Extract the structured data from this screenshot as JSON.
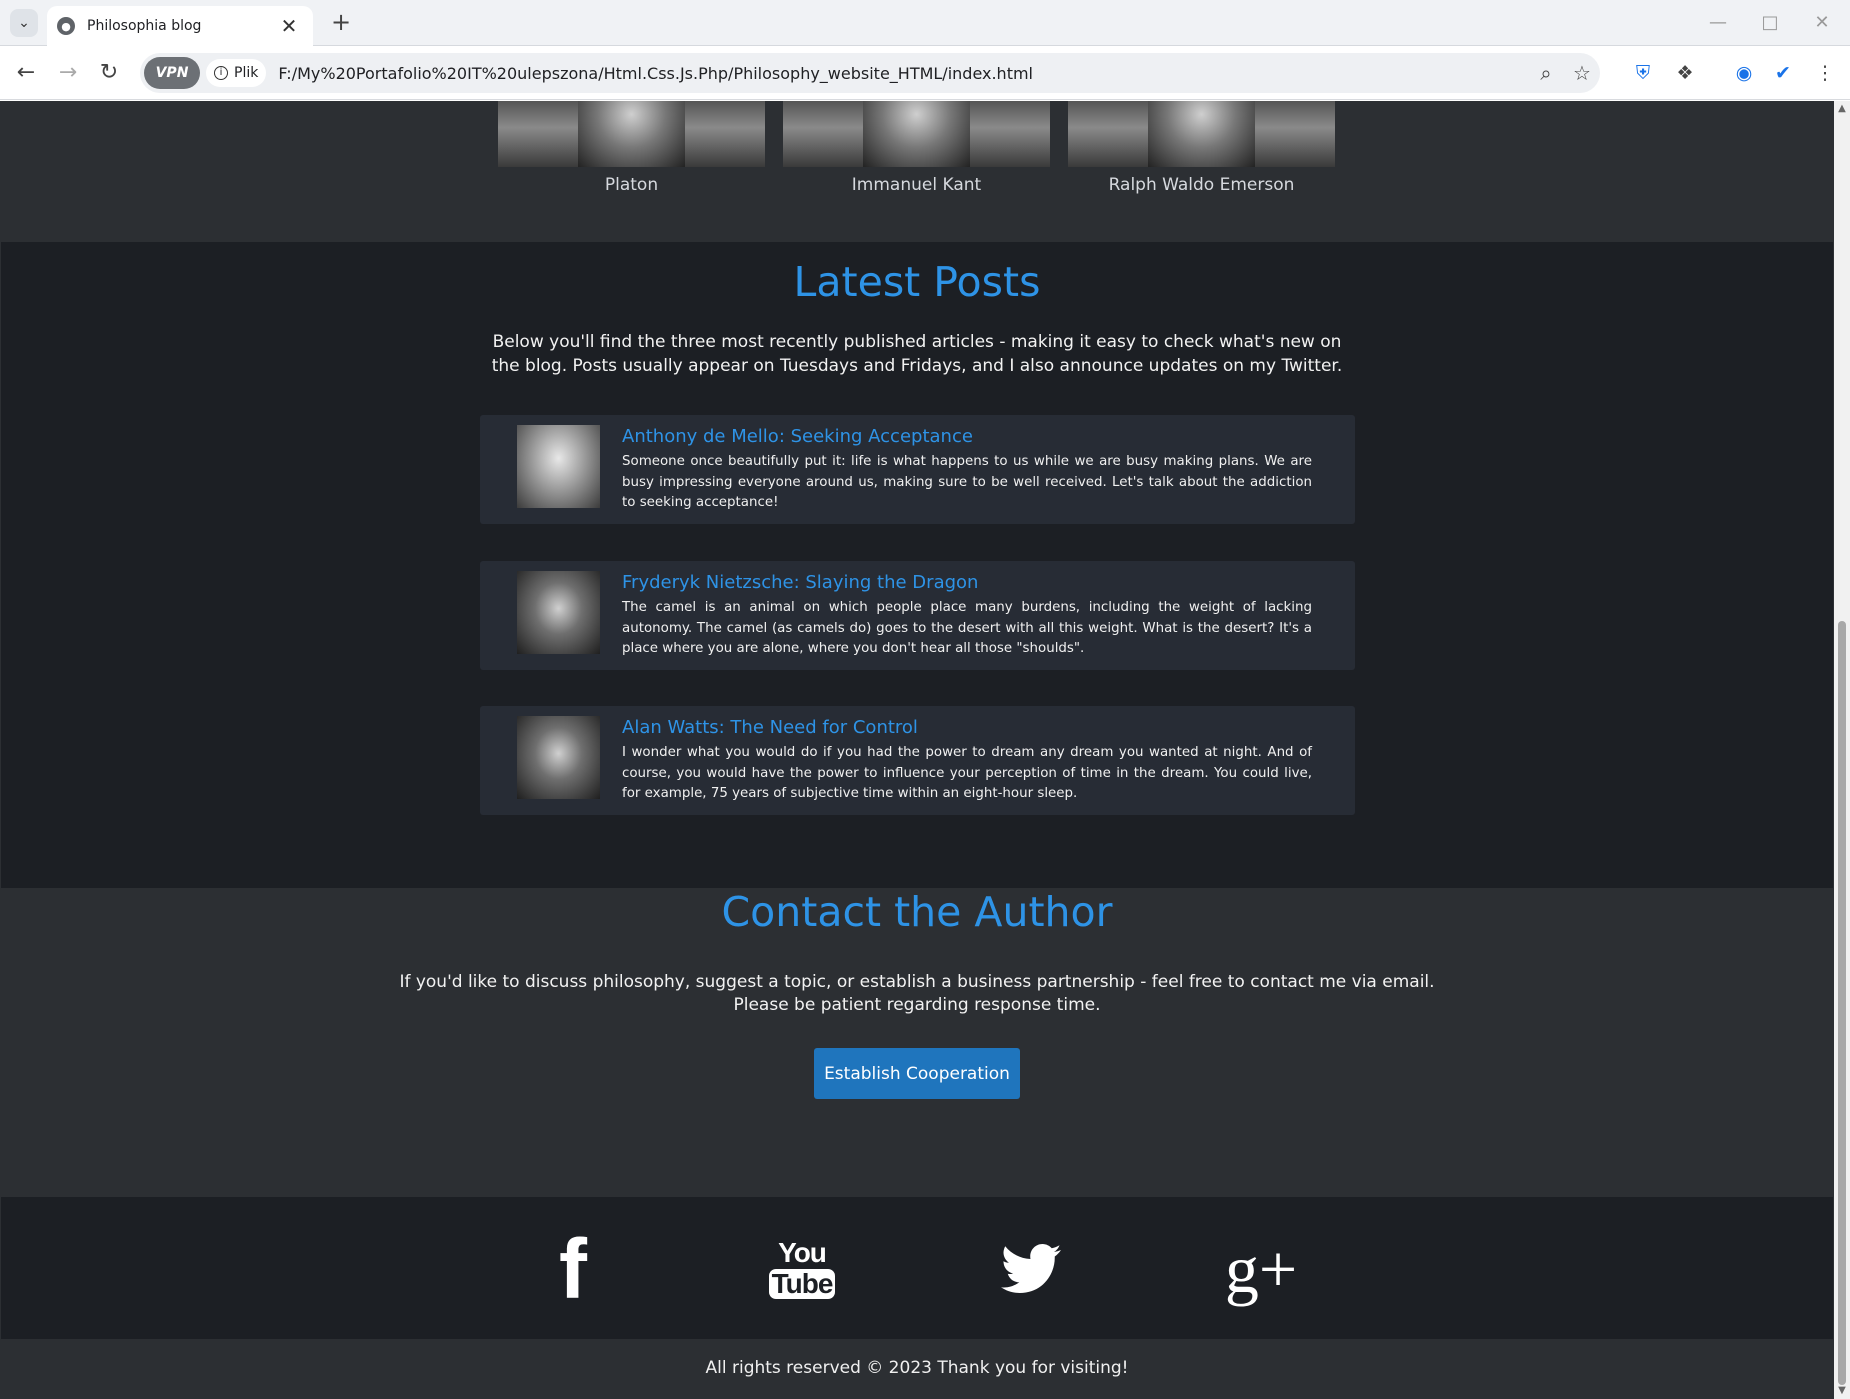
{
  "browser": {
    "tab_title": "Philosophia blog",
    "site_info_label": "Plik",
    "vpn_label": "VPN",
    "url": "F:/My%20Portafolio%20IT%20ulepszona/Html.Css.Js.Php/Philosophy_website_HTML/index.html"
  },
  "philosophers": [
    {
      "name": "Platon"
    },
    {
      "name": "Immanuel Kant"
    },
    {
      "name": "Ralph Waldo Emerson"
    }
  ],
  "latest_posts": {
    "title": "Latest Posts",
    "description": "Below you'll find the three most recently published articles - making it easy to check what's new on the blog. Posts usually appear on Tuesdays and Fridays, and I also announce updates on my Twitter.",
    "posts": [
      {
        "title": "Anthony de Mello: Seeking Acceptance",
        "excerpt": "Someone once beautifully put it: life is what happens to us while we are busy making plans. We are busy impressing everyone around us, making sure to be well received. Let's talk about the addiction to seeking acceptance!"
      },
      {
        "title": "Fryderyk Nietzsche: Slaying the Dragon",
        "excerpt": "The camel is an animal on which people place many burdens, including the weight of lacking autonomy. The camel (as camels do) goes to the desert with all this weight. What is the desert? It's a place where you are alone, where you don't hear all those \"shoulds\"."
      },
      {
        "title": "Alan Watts: The Need for Control",
        "excerpt": "I wonder what you would do if you had the power to dream any dream you wanted at night. And of course, you would have the power to influence your perception of time in the dream. You could live, for example, 75 years of subjective time within an eight-hour sleep."
      }
    ]
  },
  "contact": {
    "title": "Contact the Author",
    "description_line1": "If you'd like to discuss philosophy, suggest a topic, or establish a business partnership - feel free to contact me via email.",
    "description_line2": "Please be patient regarding response time.",
    "button_label": "Establish Cooperation"
  },
  "social": {
    "facebook_glyph": "f",
    "youtube_glyph_top": "You",
    "youtube_glyph_bottom": "Tube",
    "googleplus_glyph": "g+"
  },
  "footer": {
    "text": "All rights reserved © 2023 Thank you for visiting!"
  },
  "colors": {
    "accent": "#2e93e6",
    "button": "#1f75bd",
    "dark_bg": "#1c1f24",
    "mid_bg": "#2c2f33",
    "card_bg": "#272c35"
  }
}
